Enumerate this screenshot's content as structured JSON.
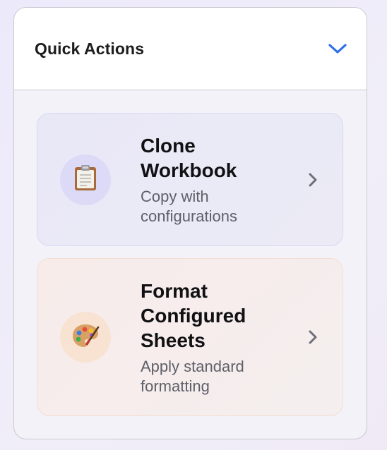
{
  "panel": {
    "title": "Quick Actions",
    "toggle_icon": "chevron-down-icon",
    "accent_color": "#2f6fe8"
  },
  "actions": [
    {
      "title_line1": "Clone",
      "title_line2": "Workbook",
      "desc_line1": "Copy with",
      "desc_line2": "configurations",
      "icon": "clipboard-icon",
      "icon_bg": "#dcdaf6"
    },
    {
      "title_line1": "Format",
      "title_line2": "Configured",
      "title_line3": "Sheets",
      "desc_line1": "Apply standard",
      "desc_line2": "formatting",
      "icon": "palette-icon",
      "icon_bg": "#f8e3d3"
    }
  ]
}
